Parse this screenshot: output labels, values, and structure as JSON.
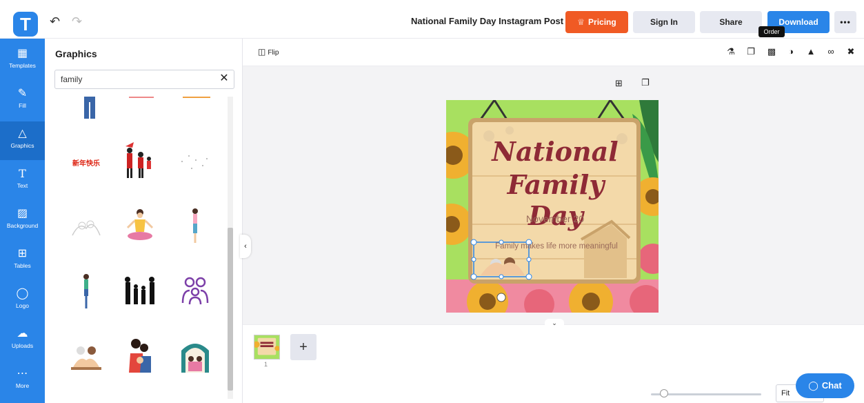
{
  "header": {
    "logo_letter": "T",
    "undo_icon": "undo-icon",
    "redo_icon": "redo-icon",
    "doc_title": "National Family Day Instagram Post",
    "pricing_label": "Pricing",
    "signin_label": "Sign In",
    "share_label": "Share",
    "download_label": "Download",
    "more_label": "•••",
    "order_tooltip": "Order",
    "accent": "#2a85e8",
    "pricing_color": "#f05a24"
  },
  "rail": {
    "items": [
      {
        "label": "Templates",
        "icon": "templates-icon"
      },
      {
        "label": "Fill",
        "icon": "pencil-icon"
      },
      {
        "label": "Graphics",
        "icon": "shapes-icon"
      },
      {
        "label": "Text",
        "icon": "text-icon"
      },
      {
        "label": "Background",
        "icon": "background-icon"
      },
      {
        "label": "Tables",
        "icon": "table-icon"
      },
      {
        "label": "Logo",
        "icon": "logo-icon"
      },
      {
        "label": "Uploads",
        "icon": "upload-icon"
      },
      {
        "label": "More",
        "icon": "more-icon"
      }
    ],
    "active": "Graphics"
  },
  "panel": {
    "title": "Graphics",
    "search_value": "family",
    "search_placeholder": "",
    "clear_icon": "close-icon",
    "chinese_text": "新年快乐"
  },
  "toolbar": {
    "flip_label": "Flip",
    "icons": [
      "paint-roller-icon",
      "copy-style-icon",
      "order-icon",
      "opacity-icon",
      "align-icon",
      "link-icon",
      "trash-icon"
    ]
  },
  "card": {
    "title_line1": "National",
    "title_line2": "Family Day",
    "date": "November 20",
    "tagline": "Family makes life more meaningful"
  },
  "bottom": {
    "page_number": "1",
    "add_page_label": "+",
    "zoom_label": "Fit",
    "chat_label": "Chat"
  }
}
